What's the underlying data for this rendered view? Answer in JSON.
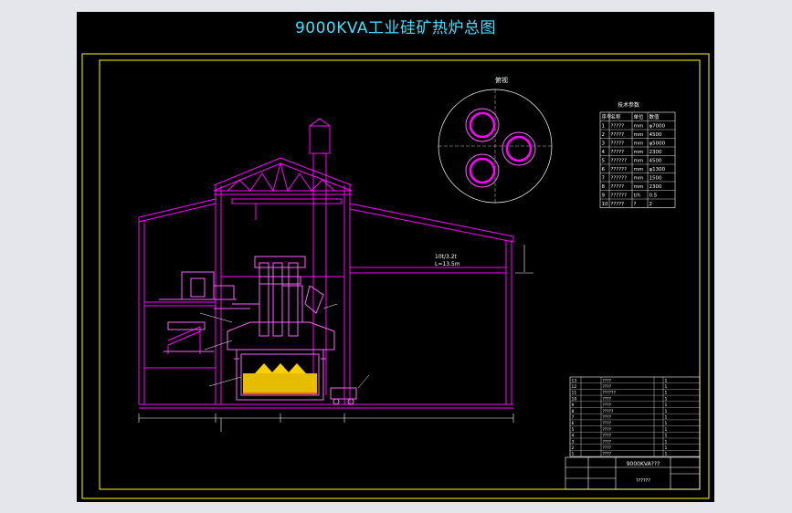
{
  "title": "9000KVA工业硅矿热炉总图",
  "colors": {
    "background": "#000000",
    "frame": "#ffff00",
    "structure": "#ff00ff",
    "equipment": "#ff60ff",
    "dimension": "#ffffff",
    "title": "#40e0ff",
    "furnace_fill": "#ffd000"
  },
  "labels": {
    "top_view": "俯视",
    "params_title": "技术参数",
    "crane": "10t/3.2t",
    "span": "L=13.5m",
    "drawing_name": "9000KVA???",
    "drawing_sub": "??????"
  },
  "params_header": [
    "序号",
    "名称",
    "单位",
    "数值"
  ],
  "params": [
    [
      "1",
      "?????",
      "mm",
      "φ7000"
    ],
    [
      "2",
      "?????",
      "mm",
      "4500"
    ],
    [
      "3",
      "?????",
      "mm",
      "φ5000"
    ],
    [
      "4",
      "?????",
      "mm",
      "2300"
    ],
    [
      "5",
      "??????",
      "mm",
      "4500"
    ],
    [
      "6",
      "??????",
      "mm",
      "φ1300"
    ],
    [
      "7",
      "??????",
      "mm",
      "1500"
    ],
    [
      "8",
      "?????",
      "mm",
      "2300"
    ],
    [
      "9",
      "??????",
      "t/h",
      "0.5"
    ],
    [
      "10",
      "?????",
      "?",
      "2"
    ]
  ],
  "bom": [
    [
      "13",
      "????",
      "",
      "1"
    ],
    [
      "12",
      "????",
      "",
      "1"
    ],
    [
      "11",
      "??????",
      "",
      "1"
    ],
    [
      "10",
      "????",
      "",
      "1"
    ],
    [
      "9",
      "????",
      "",
      "1"
    ],
    [
      "8",
      "?????",
      "",
      "1"
    ],
    [
      "7",
      "????",
      "",
      "1"
    ],
    [
      "6",
      "????",
      "",
      "1"
    ],
    [
      "5",
      "????",
      "",
      "1"
    ],
    [
      "4",
      "????",
      "",
      "1"
    ],
    [
      "3",
      "????",
      "",
      "1"
    ],
    [
      "2",
      "????",
      "",
      "1"
    ],
    [
      "1",
      "????",
      "",
      "1"
    ]
  ]
}
